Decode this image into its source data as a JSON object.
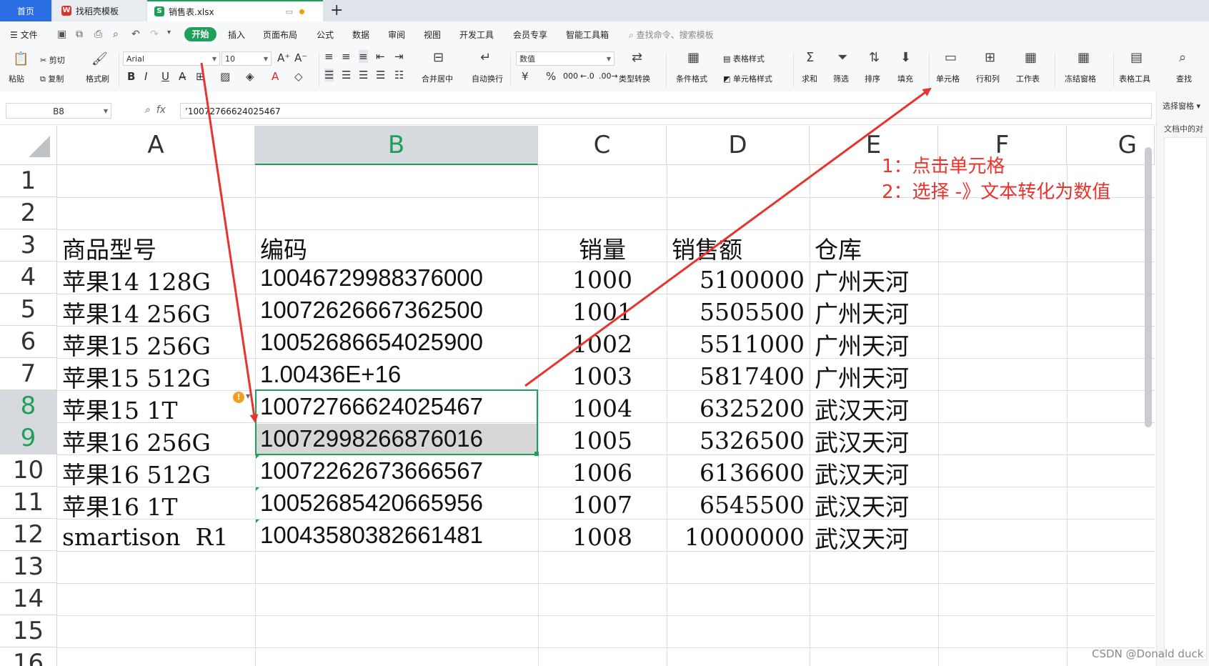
{
  "tabs": {
    "home": "首页",
    "template": "找稻壳模板",
    "file": "销售表.xlsx"
  },
  "menu": {
    "file": "文件",
    "start": "开始",
    "items": [
      "插入",
      "页面布局",
      "公式",
      "数据",
      "审阅",
      "视图",
      "开发工具",
      "会员专享",
      "智能工具箱"
    ],
    "search_placeholder": "查找命令、搜索模板"
  },
  "ribbon": {
    "paste": "粘贴",
    "cut": "剪切",
    "copy": "复制",
    "format_painter": "格式刷",
    "font_name": "Arial",
    "font_size": "10",
    "merge_center": "合并居中",
    "wrap_text": "自动换行",
    "number_format": "数值",
    "type_convert": "类型转换",
    "conditional_format": "条件格式",
    "table_style": "表格样式",
    "cell_style": "单元格样式",
    "sum": "求和",
    "filter": "筛选",
    "sort": "排序",
    "fill": "填充",
    "cell": "单元格",
    "row_col": "行和列",
    "worksheet": "工作表",
    "freeze": "冻结窗格",
    "table_tools": "表格工具",
    "find": "查找",
    "currency": "¥",
    "percent": "%",
    "thousands": "000"
  },
  "formula_bar": {
    "name_box": "B8",
    "fx": "fx",
    "content": "’10072766624025467"
  },
  "side_pane": {
    "title": "选择窗格",
    "subtitle": "文档中的对"
  },
  "columns": [
    "A",
    "B",
    "C",
    "D",
    "E",
    "F",
    "G"
  ],
  "rows": [
    "1",
    "2",
    "3",
    "4",
    "5",
    "6",
    "7",
    "8",
    "9",
    "10",
    "11",
    "12",
    "13",
    "14",
    "15",
    "16"
  ],
  "header_row": {
    "a": "商品型号",
    "b": "编码",
    "c": "销量",
    "d": "销售额",
    "e": "仓库"
  },
  "data_rows": [
    {
      "a": "苹果14 128G",
      "b": "10046729988376000",
      "c": "1000",
      "d": "5100000",
      "e": "广州天河"
    },
    {
      "a": "苹果14 256G",
      "b": "10072626667362500",
      "c": "1001",
      "d": "5505500",
      "e": "广州天河"
    },
    {
      "a": "苹果15 256G",
      "b": "10052686654025900",
      "c": "1002",
      "d": "5511000",
      "e": "广州天河"
    },
    {
      "a": "苹果15 512G",
      "b": "1.00436E+16",
      "c": "1003",
      "d": "5817400",
      "e": "广州天河"
    },
    {
      "a": "苹果15 1T",
      "b": "10072766624025467",
      "c": "1004",
      "d": "6325200",
      "e": "武汉天河"
    },
    {
      "a": "苹果16 256G",
      "b": "10072998266876016",
      "c": "1005",
      "d": "5326500",
      "e": "武汉天河"
    },
    {
      "a": "苹果16 512G",
      "b": "10072262673666567",
      "c": "1006",
      "d": "6136600",
      "e": "武汉天河"
    },
    {
      "a": "苹果16 1T",
      "b": "10052685420665956",
      "c": "1007",
      "d": "6545500",
      "e": "武汉天河"
    },
    {
      "a": "smartison  R1",
      "b": "10043580382661481",
      "c": "1008",
      "d": "10000000",
      "e": "武汉天河"
    }
  ],
  "annotations": {
    "step1": "1：点击单元格",
    "step2": "2：选择 -》文本转化为数值",
    "color": "#e8332e"
  },
  "watermark": "CSDN @Donald duck",
  "colors": {
    "accent": "#1e9f5a",
    "home_tab": "#2b6de3",
    "selection_fill": "#d7d7d7"
  }
}
